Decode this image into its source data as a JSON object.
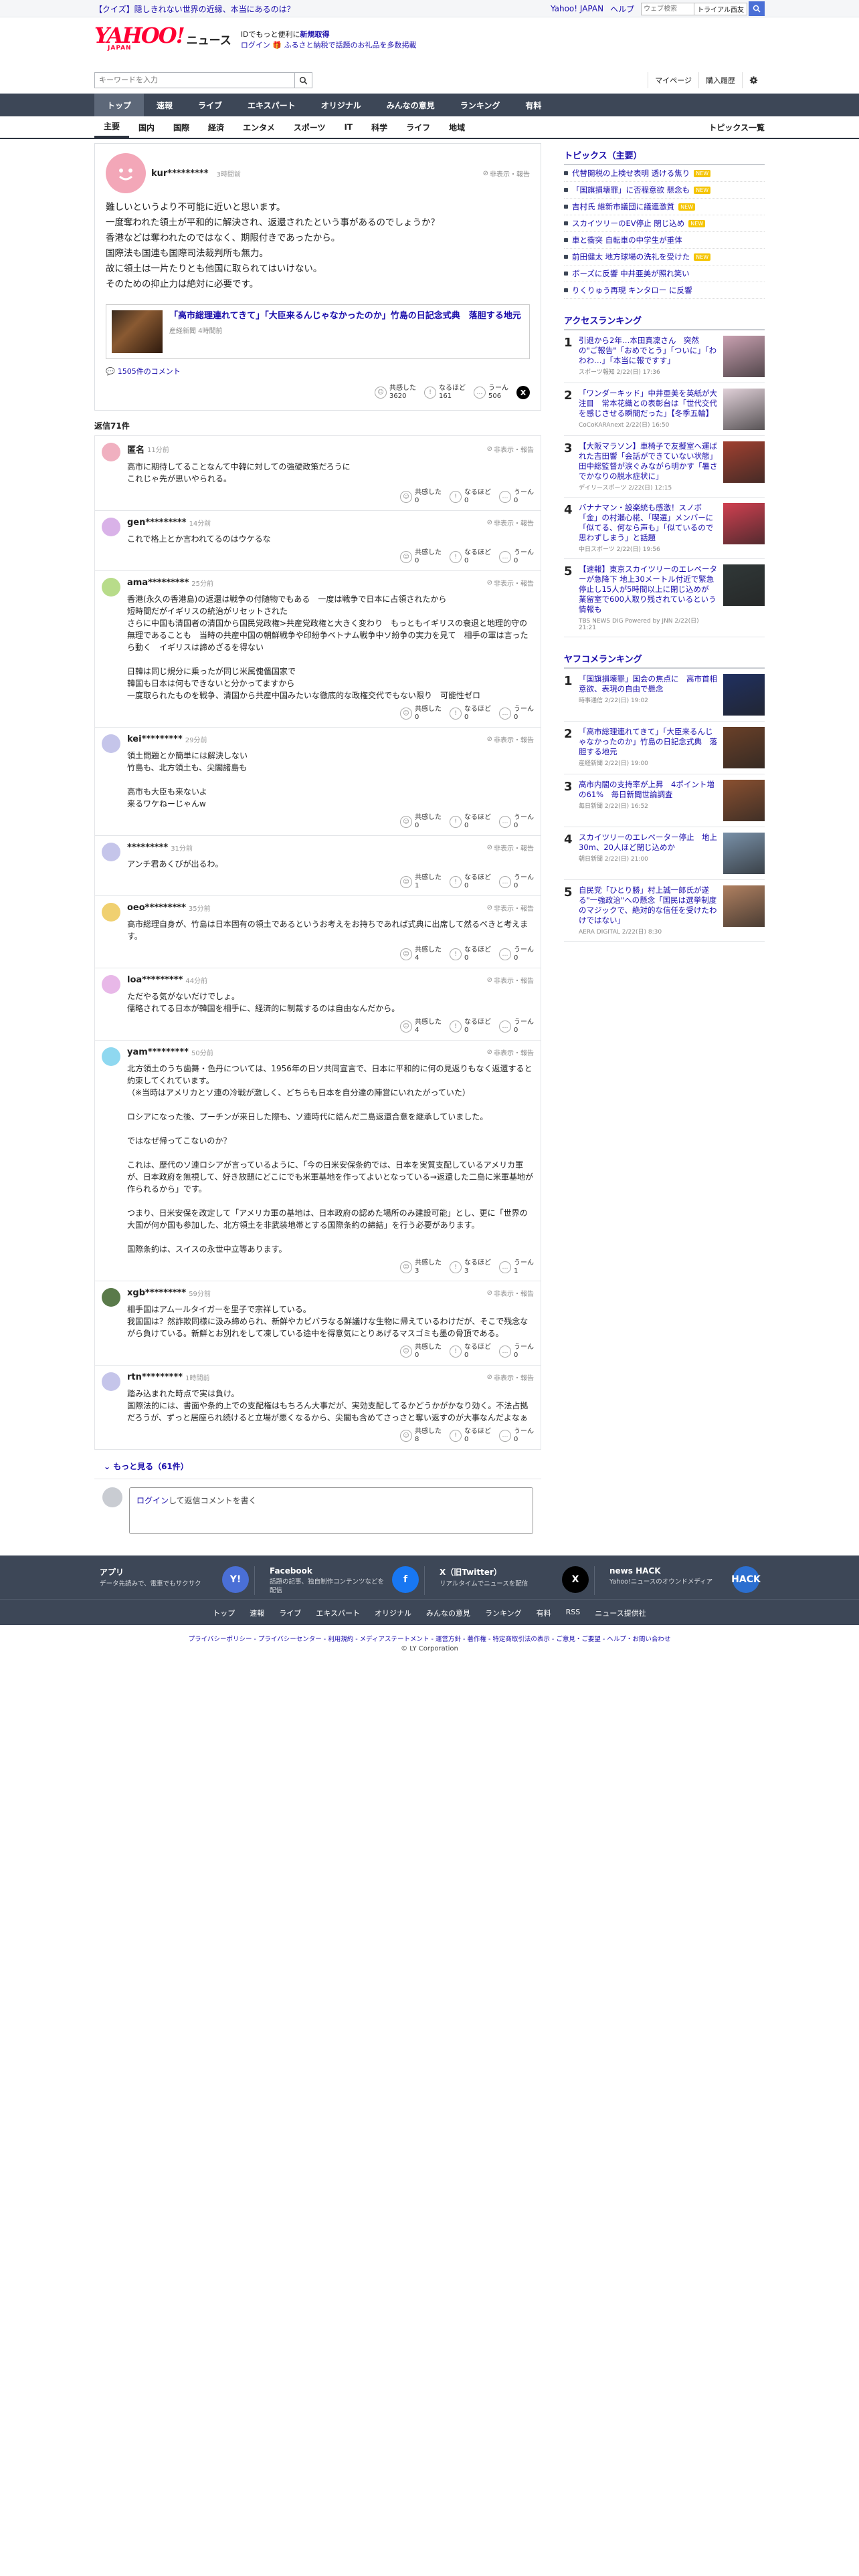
{
  "topbar": {
    "quiz": "【クイズ】隠しきれない世界の近縁、本当にあるのは？",
    "links": [
      "Yahoo! JAPAN",
      "ヘルプ"
    ],
    "search_placeholder": "ウェブ検索",
    "toggle_label": "トライアル西友"
  },
  "masthead": {
    "logo": "YAHOO!",
    "logo_sub": "JAPAN",
    "section": "ニュース",
    "promo_line1": "IDでもっと便利に",
    "promo_line1_bold": "新規取得",
    "promo_line2": "ログイン 🎁 ふるさと納税で話題のお礼品を多数掲載"
  },
  "search": {
    "placeholder": "キーワードを入力",
    "mypage": "マイページ",
    "history": "購入履歴"
  },
  "gnav": [
    "トップ",
    "速報",
    "ライブ",
    "エキスパート",
    "オリジナル",
    "みんなの意見",
    "ランキング",
    "有料"
  ],
  "subnav": [
    "主要",
    "国内",
    "国際",
    "経済",
    "エンタメ",
    "スポーツ",
    "IT",
    "科学",
    "ライフ",
    "地域"
  ],
  "subnav_right": "トピックス一覧",
  "comment": {
    "user": "kur*********",
    "time": "3時間前",
    "hide_report": "非表示・報告",
    "text": "難しいというより不可能に近いと思います。\n一度奪われた領土が平和的に解決され、返還されたという事があるのでしょうか？\n香港などは奪われたのではなく、期限付きであったから。\n国際法も国連も国際司法裁判所も無力。\n故に領土は一片たりとも他国に取られてはいけない。\nそのための抑止力は絶対に必要です。",
    "article_title": "「高市総理連れてきて」「大臣来るんじゃなかったのか」竹島の日記念式典　落胆する地元",
    "article_meta": "産経新聞 4時間前",
    "comments_link": "1505件のコメント",
    "reactions": [
      {
        "label": "共感した",
        "count": "3620",
        "icon": "☺"
      },
      {
        "label": "なるほど",
        "count": "161",
        "icon": "!"
      },
      {
        "label": "うーん",
        "count": "506",
        "icon": "…"
      }
    ],
    "replies_label": "返信71件"
  },
  "replies": [
    {
      "user": "匿名",
      "time": "11分前",
      "avatar": "#f0b0c0",
      "text": "高市に期待してることなんて中韓に対しての強硬政策だろうに\nこれじゃ先が思いやられる。",
      "r": [
        "0",
        "0",
        "0"
      ]
    },
    {
      "user": "gen*********",
      "time": "14分前",
      "avatar": "#d9b2e8",
      "text": "これで格上とか言われてるのはウケるな",
      "r": [
        "0",
        "0",
        "0"
      ]
    },
    {
      "user": "ama*********",
      "time": "25分前",
      "avatar": "#b8dc8a",
      "text": "香港(永久の香港島)の返還は戦争の付随物でもある　一度は戦争で日本に占領されたから\n短時間だがイギリスの統治がリセットされた\nさらに中国も清国者の清国から国民党政権>共産党政権と大きく変わり　もっともイギリスの衰退と地理的守の無理であることも　当時の共産中国の朝鮮戦争や印紛争ベトナム戦争中ソ紛争の実力を見て　相手の軍は言ったら動く　イギリスは諦めざるを得ない\n\n日韓は同じ規分に乗ったが同じ米属傀儡国家で\n韓国も日本は何もできないと分かってますから\n一度取られたものを戦争、清国から共産中国みたいな徹底的な政権交代でもない限り　可能性ゼロ",
      "r": [
        "0",
        "0",
        "0"
      ]
    },
    {
      "user": "kei*********",
      "time": "29分前",
      "avatar": "#c5c5ea",
      "text": "領土問題とか簡単には解決しない\n竹島も、北方領土も、尖閣諸島も\n\n高市も大臣も来ないよ\n来るワケねーじゃんw",
      "r": [
        "0",
        "0",
        "0"
      ]
    },
    {
      "user": "*********",
      "time": "31分前",
      "avatar": "#c5c5ea",
      "text": "アンチ君あくびが出るわ。",
      "r": [
        "1",
        "0",
        "0"
      ]
    },
    {
      "user": "oeo*********",
      "time": "35分前",
      "avatar": "#f0d070",
      "text": "高市総理自身が、竹島は日本固有の領土であるというお考えをお持ちであれば式典に出席して然るべきと考えます。",
      "r": [
        "4",
        "0",
        "0"
      ]
    },
    {
      "user": "loa*********",
      "time": "44分前",
      "avatar": "#e8b8e8",
      "text": "ただやる気がないだけでしょ。\n儒略されてる日本が韓国を相手に、経済的に制裁するのは自由なんだから。",
      "r": [
        "4",
        "0",
        "0"
      ]
    },
    {
      "user": "yam*********",
      "time": "50分前",
      "avatar": "#8fd8f0",
      "text": "北方領土のうち歯舞・色丹については、1956年の日ソ共同宣言で、日本に平和的に何の見返りもなく返還すると約束してくれています。\n（※当時はアメリカとソ連の冷戦が激しく、どちらも日本を自分達の陣営にいれたがっていた）\n\nロシアになった後、プーチンが来日した際も、ソ連時代に結んだ二島返還合意を継承していました。\n\nではなぜ帰ってこないのか？\n\nこれは、歴代のソ連ロシアが言っているように、「今の日米安保条約では、日本を実質支配しているアメリカ軍が、日本政府を無視して、好き放題にどこにでも米軍基地を作ってよいとなっている→返還した二島に米軍基地が作られるから」です。\n\nつまり、日米安保を改定して「アメリカ軍の基地は、日本政府の認めた場所のみ建設可能」とし、更に「世界の大国が何か国も参加した、北方領土を非武装地帯とする国際条約の締結」を行う必要があります。\n\n国際条約は、スイスの永世中立等あります。",
      "r": [
        "3",
        "3",
        "1"
      ]
    },
    {
      "user": "xgb*********",
      "time": "59分前",
      "avatar": "#5a7a4a",
      "text": "相手国はアムールタイガーを里子で宗祥している。\n我国国は？然詐欺同様に汲み締められ、新鮮やカビバラなる鮮議けな生物に帰えているわけだが、そこで残念ながら負けている。新鮮とお別れをして凍している途中を得意気にとりあげるマスゴミも墨の骨頂である。",
      "r": [
        "0",
        "0",
        "0"
      ]
    },
    {
      "user": "rtn*********",
      "time": "1時間前",
      "avatar": "#c5c5ea",
      "text": "踏み込まれた時点で実は負け。\n国際法的には、書面や条約上での支配権はもちろん大事だが、実効支配してるかどうかがかなり効く。不法占拠だろうが、ずっと居座られ続けると立場が悪くなるから、尖閣も含めてさっさと奪い返すのが大事なんだよなぁ",
      "r": [
        "8",
        "0",
        "0"
      ]
    }
  ],
  "more": "もっと見る（61件）",
  "reply_box": {
    "login": "ログイン",
    "rest": "して返信コメントを書く"
  },
  "sidebar": {
    "topics_title": "トピックス（主要）",
    "topics": [
      {
        "t": "代替開税の上検せ表明 透ける焦り",
        "new": true
      },
      {
        "t": "「国旗損壊罪」に否程意欲 懸念も",
        "new": true
      },
      {
        "t": "吉村氏 維新市議団に議連激質",
        "new": true
      },
      {
        "t": "スカイツリーのEV停止 閉じ込め",
        "new": true
      },
      {
        "t": "車と衝突 自転車の中学生が重体",
        "new": false
      },
      {
        "t": "前田健太 地方球場の洗礼を受けた",
        "new": true
      },
      {
        "t": "ボーズに反響 中井亜美が照れ笑い",
        "new": false
      },
      {
        "t": "りくりゅう再現 キンタロー に反響",
        "new": false
      }
    ],
    "access_title": "アクセスランキング",
    "access": [
      {
        "t": "引退から2年…本田真凜さん　突然の\"ご報告\"「おめでとう」「ついに」「わわわ…」「本当に報ですす」",
        "m": "スポーツ報知 2/22(日) 17:36",
        "c": "#c8a0b0"
      },
      {
        "t": "「ワンダーキッド」中井亜美を英紙が大注目　常本花織との表彰台は「世代交代を感じさせる瞬間だった」【冬季五輪】",
        "m": "CoCoKARAnext 2/22(日) 16:50",
        "c": "#e0d0d8"
      },
      {
        "t": "【大阪マラソン】車椅子で友擬室へ運ばれた吉田響「会話ができていない状態」田中総監督が涙ぐみながら明かす「暑さでかなりの脱水症状に」",
        "m": "デイリースポーツ 2/22(日) 12:15",
        "c": "#a04030"
      },
      {
        "t": "バナナマン・設楽統も感激！スノボ「金」の村瀬心椛、「喫選」メンバーに「似てる、何なら声も」「似ているので思わずしまう」と話題",
        "m": "中日スポーツ 2/22(日) 19:56",
        "c": "#d04050"
      },
      {
        "t": "【速報】東京スカイツリーのエレベーターが急降下 地上30メートル付近で緊急停止し15人が5時間以上に閉じ込めが 業留室で600人取り残されているという情報も",
        "m": "TBS NEWS DIG Powered by JNN 2/22(日) 21:21",
        "c": "#303838"
      }
    ],
    "yahoo_title": "ヤフコメランキング",
    "yahoo": [
      {
        "t": "「国旗損壊罪」国会の焦点に　高市首相意欲、表現の自由で懸念",
        "m": "時事通信 2/22(日) 19:02",
        "c": "#203060"
      },
      {
        "t": "「高市総理連れてきて」「大臣来るんじゃなかったのか」竹島の日記念式典　落胆する地元",
        "m": "産経新聞 2/22(日) 19:00",
        "c": "#6a4028"
      },
      {
        "t": "高市内閣の支持率が上昇　4ポイント増の61%　毎日新聞世論調査",
        "m": "毎日新聞 2/22(日) 16:52",
        "c": "#8a5030"
      },
      {
        "t": "スカイツリーのエレベーター停止　地上30m、20人ほど閉じ込めか",
        "m": "朝日新聞 2/22(日) 21:00",
        "c": "#7890a8"
      },
      {
        "t": "自民党「ひとり勝」村上誠一郎氏が遂る\"一強政治\"への懸念「国民は選挙制度のマジックで、絶対的な信任を受けたわけではない」",
        "m": "AERA DIGITAL 2/22(日) 8:30",
        "c": "#b08060"
      }
    ]
  },
  "footer": {
    "apps": [
      {
        "t": "アプリ",
        "d": "データ先読みで、電車でもサクサク",
        "c": "#4a6fd6",
        "i": "Y!"
      },
      {
        "t": "Facebook",
        "d": "話題の記事、独自制作コンテンツなどを配信",
        "c": "#1877f2",
        "i": "f"
      },
      {
        "t": "X（旧Twitter）",
        "d": "リアルタイムでニュースを配信",
        "c": "#000000",
        "i": "X"
      },
      {
        "t": "news HACK",
        "d": "Yahoo!ニュースのオウンドメディア",
        "c": "#2c6fd0",
        "i": "HACK"
      }
    ],
    "nav": [
      "トップ",
      "速報",
      "ライブ",
      "エキスパート",
      "オリジナル",
      "みんなの意見",
      "ランキング",
      "有料",
      "RSS",
      "ニュース提供社"
    ],
    "links": "プライバシーポリシー - プライバシーセンター - 利用規約 - メディアステートメント - 運営方針 - 著作権 - 特定商取引法の表示 - ご意見・ご要望 - ヘルプ・お問い合わせ",
    "copy": "© LY Corporation"
  }
}
